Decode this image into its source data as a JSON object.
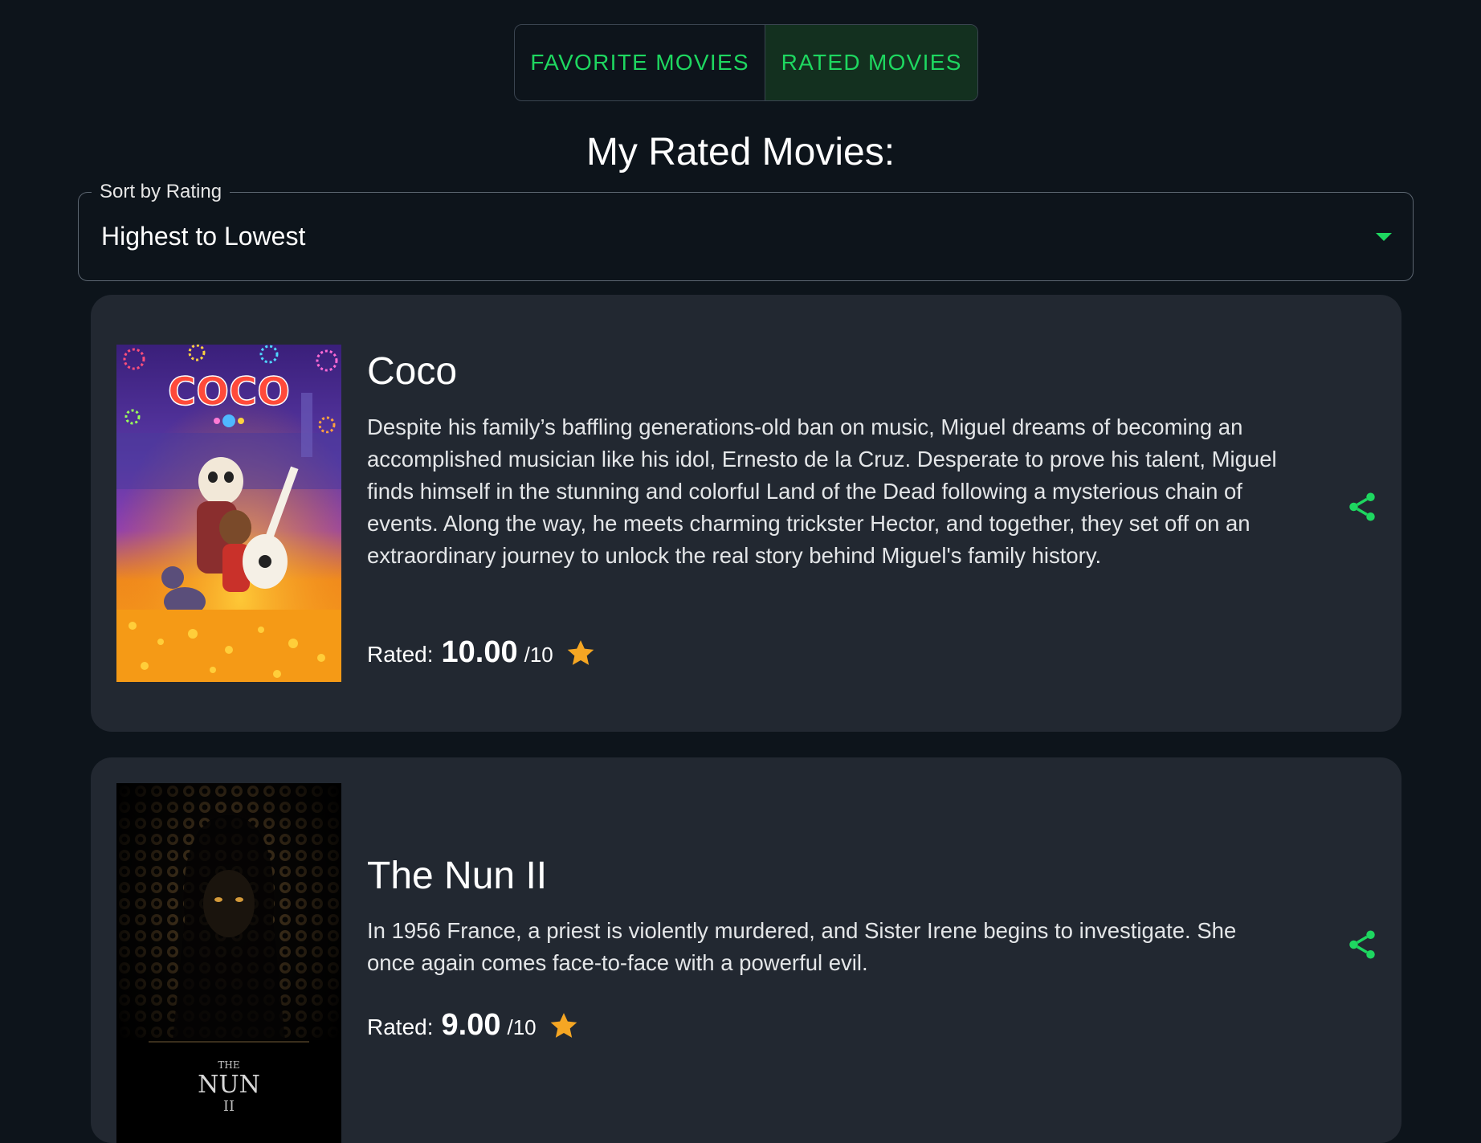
{
  "tabs": {
    "favorite_label": "FAVORITE MOVIES",
    "rated_label": "RATED MOVIES",
    "active": "rated"
  },
  "page_title": "My Rated Movies:",
  "sort": {
    "label": "Sort by Rating",
    "value": "Highest to Lowest"
  },
  "movies": [
    {
      "title": "Coco",
      "overview": "Despite his family’s baffling generations-old ban on music, Miguel dreams of becoming an accomplished musician like his idol, Ernesto de la Cruz. Desperate to prove his talent, Miguel finds himself in the stunning and colorful Land of the Dead following a mysterious chain of events. Along the way, he meets charming trickster Hector, and together, they set off on an extraordinary journey to unlock the real story behind Miguel's family history.",
      "rated_label": "Rated:",
      "rating": "10.00",
      "rating_max": "/10",
      "poster_text": "COCO"
    },
    {
      "title": "The Nun II",
      "overview": "In 1956 France, a priest is violently murdered, and Sister Irene begins to investigate. She once again comes face-to-face with a powerful evil.",
      "rated_label": "Rated:",
      "rating": "9.00",
      "rating_max": "/10",
      "poster_text": "THE NUN II"
    }
  ],
  "colors": {
    "background": "#0d141b",
    "card": "#222831",
    "accent": "#1ed760",
    "star": "#f5a623",
    "active_tab": "#13301f"
  },
  "icons": {
    "share": "share-icon",
    "star": "star-icon",
    "dropdown": "chevron-down-icon"
  }
}
